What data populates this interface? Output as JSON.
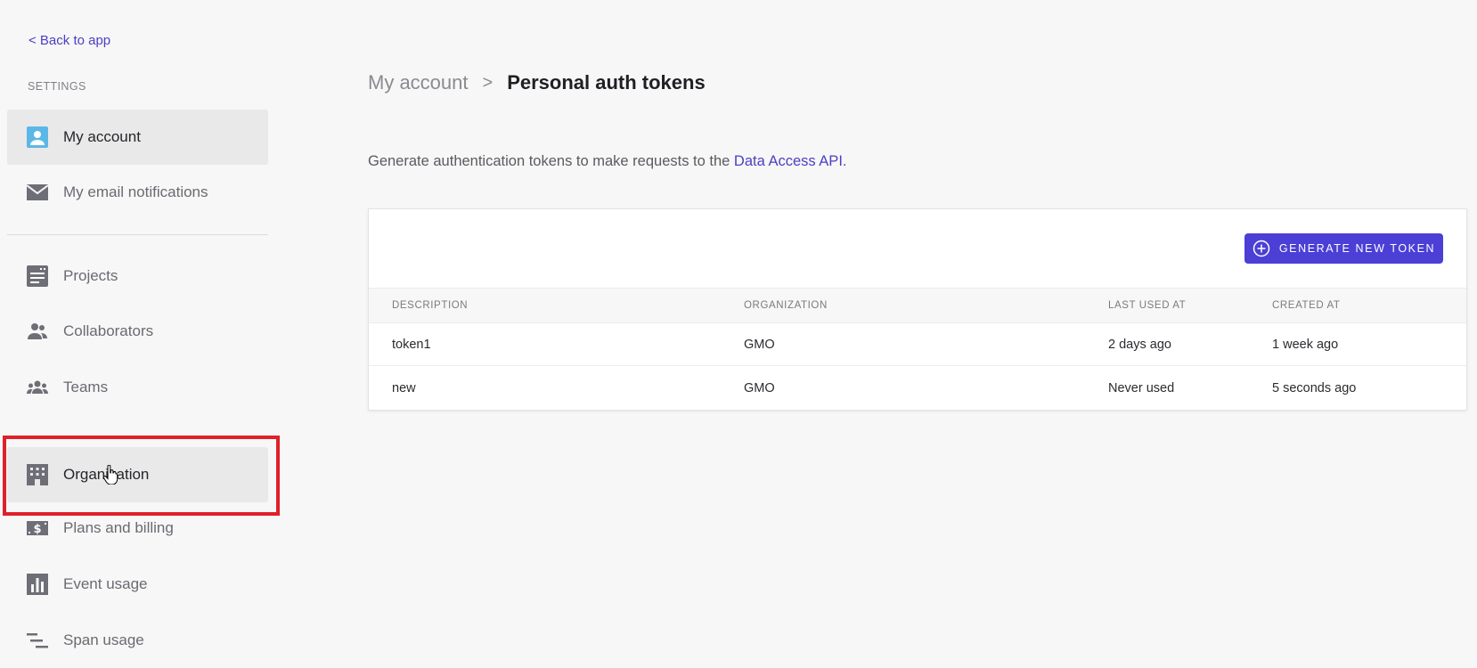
{
  "sidebar": {
    "back_link": "< Back to app",
    "section_label": "SETTINGS",
    "items_top": [
      {
        "label": "My account",
        "icon": "user-icon",
        "active": true
      },
      {
        "label": "My email notifications",
        "icon": "mail-icon"
      }
    ],
    "items_bottom": [
      {
        "label": "Projects",
        "icon": "projects-icon"
      },
      {
        "label": "Collaborators",
        "icon": "collaborators-icon"
      },
      {
        "label": "Teams",
        "icon": "teams-icon"
      },
      {
        "label": "Organization",
        "icon": "building-icon",
        "hovered": true
      },
      {
        "label": "Plans and billing",
        "icon": "billing-icon"
      },
      {
        "label": "Event usage",
        "icon": "bar-chart-icon"
      },
      {
        "label": "Span usage",
        "icon": "span-icon"
      }
    ]
  },
  "header": {
    "breadcrumb_parent": "My account",
    "breadcrumb_sep": ">",
    "breadcrumb_current": "Personal auth tokens"
  },
  "description": {
    "text": "Generate authentication tokens to make requests to the ",
    "link": "Data Access API",
    "suffix": "."
  },
  "tokens": {
    "generate_button": "GENERATE NEW TOKEN",
    "columns": [
      "DESCRIPTION",
      "ORGANIZATION",
      "LAST USED AT",
      "CREATED AT"
    ],
    "rows": [
      [
        "token1",
        "GMO",
        "2 days ago",
        "1 week ago"
      ],
      [
        "new",
        "GMO",
        "Never used",
        "5 seconds ago"
      ]
    ]
  },
  "colors": {
    "accent": "#4b3fd6",
    "link": "#4b3fc4",
    "highlight": "#e0202a"
  }
}
